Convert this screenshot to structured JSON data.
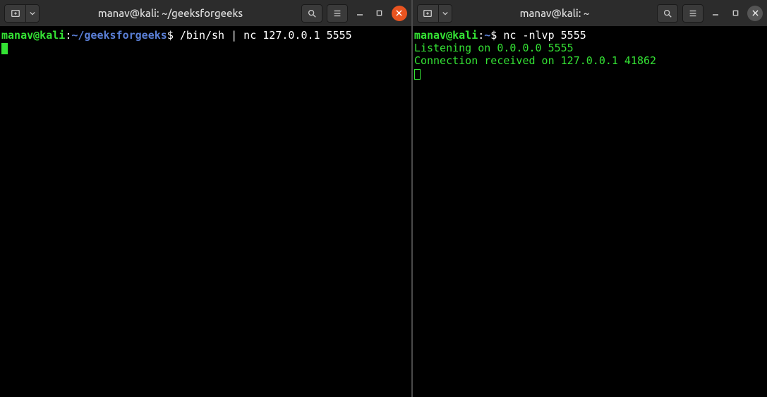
{
  "left": {
    "title": "manav@kali: ~/geeksforgeeks",
    "prompt_user": "manav@kali",
    "prompt_sep": ":",
    "prompt_path": "~/geeksforgeeks",
    "prompt_dollar": "$",
    "command": " /bin/sh | nc 127.0.0.1 5555"
  },
  "right": {
    "title": "manav@kali: ~",
    "prompt_user": "manav@kali",
    "prompt_sep": ":",
    "prompt_path": "~",
    "prompt_dollar": "$",
    "command": " nc -nlvp 5555",
    "output_line1": "Listening on 0.0.0.0 5555",
    "output_line2": "Connection received on 127.0.0.1 41862"
  }
}
